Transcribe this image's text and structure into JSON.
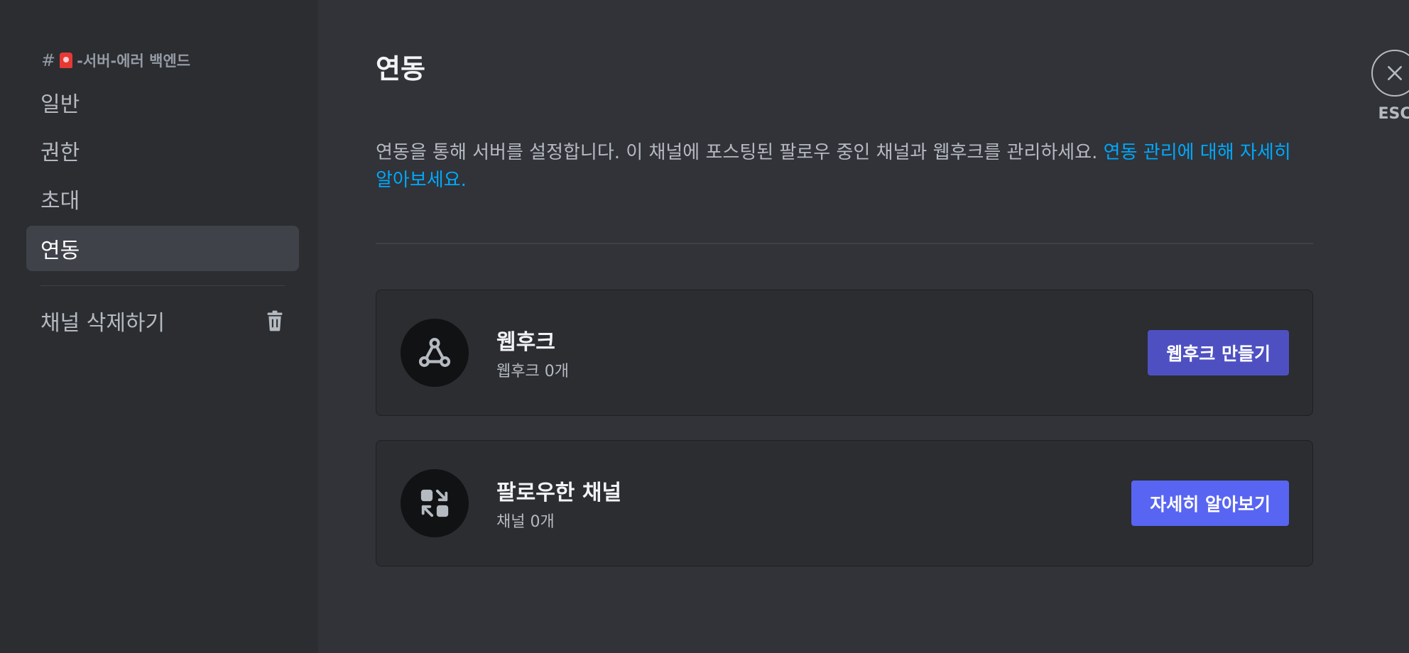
{
  "sidebar": {
    "channel_header": {
      "hash": "#",
      "channel_name": "-서버-에러 백엔드",
      "icon": "siren-icon"
    },
    "items": [
      {
        "label": "일반",
        "active": false
      },
      {
        "label": "권한",
        "active": false
      },
      {
        "label": "초대",
        "active": false
      },
      {
        "label": "연동",
        "active": true
      }
    ],
    "delete_label": "채널 삭제하기",
    "delete_icon": "trash-icon"
  },
  "main": {
    "title": "연동",
    "description": "연동을 통해 서버를 설정합니다. 이 채널에 포스팅된 팔로우 중인 채널과 웹후크를 관리하세요. ",
    "description_link": "연동 관리에 대해 자세히 알아보세요.",
    "cards": [
      {
        "icon": "webhook-icon",
        "title": "웹후크",
        "subtitle": "웹후크 0개",
        "button_label": "웹후크 만들기"
      },
      {
        "icon": "followed-channel-icon",
        "title": "팔로우한 채널",
        "subtitle": "채널 0개",
        "button_label": "자세히 알아보기"
      }
    ]
  },
  "close": {
    "icon": "close-icon",
    "label": "ESC"
  },
  "colors": {
    "sidebar_bg": "#2b2d31",
    "main_bg": "#313338",
    "link": "#00a8fc",
    "button_primary": "#5865f2",
    "button_webhook": "#4e50c2"
  }
}
